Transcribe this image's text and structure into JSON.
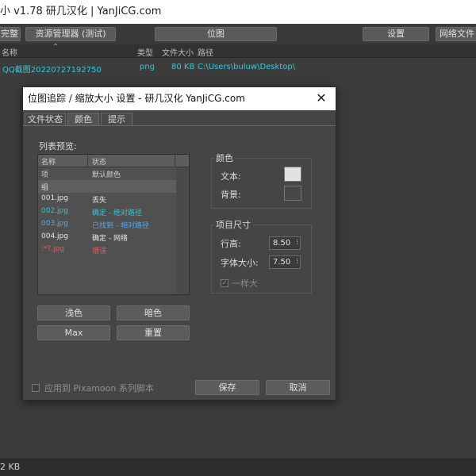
{
  "window": {
    "title": "小  v1.78  研几汉化 | YanJiCG.com"
  },
  "toolbar": {
    "complete_label": "完整",
    "asset_manager_label": "资源管理器 (测试)",
    "bitmap_label": "位图",
    "settings_label": "设置",
    "network_label": "网络文件"
  },
  "file_list": {
    "columns": {
      "name": "名称",
      "type": "类型",
      "size": "文件大小",
      "path": "路径"
    },
    "rows": [
      {
        "name": "QQ截图20220727192750",
        "type": "png",
        "size": "80 KB",
        "path": "C:\\Users\\buluw\\Desktop\\"
      }
    ]
  },
  "status_bar": {
    "text": "2 KB"
  },
  "dialog": {
    "title": "位图追踪 / 缩放大小 设置 - 研几汉化 YanJiCG.com",
    "close_glyph": "✕",
    "tabs": [
      "文件状态",
      "颜色",
      "提示"
    ],
    "active_tab": "颜色",
    "list_preview": {
      "label": "列表预览:",
      "col_name": "名称",
      "col_status": "状态",
      "rows": [
        {
          "name": "项",
          "status": "默认颜色",
          "color": "#cfcfcf"
        },
        {
          "name": "组",
          "status": "",
          "color": "#e0e0e0",
          "group": true
        },
        {
          "name": "001.jpg",
          "status": "丢失",
          "color": "#e6e6e6"
        },
        {
          "name": "002.jpg",
          "status": "确定 - 绝对路径",
          "color": "#33c4d3"
        },
        {
          "name": "003.jpg",
          "status": "已找到 - 相对路径",
          "color": "#5aa8e8"
        },
        {
          "name": "004.jpg",
          "status": "确定 - 网络",
          "color": "#e6e6e6"
        },
        {
          "name": ":*?.jpg",
          "status": "错误",
          "color": "#e85a5a"
        }
      ]
    },
    "buttons": {
      "light": "浅色",
      "dark": "暗色",
      "max": "Max",
      "reset": "重置",
      "save": "保存",
      "cancel": "取消"
    },
    "color_group": {
      "title": "颜色",
      "text_label": "文本:",
      "bg_label": "背景:",
      "text_color": "#e2e2e2",
      "bg_color": "#474747"
    },
    "size_group": {
      "title": "项目尺寸",
      "row_height_label": "行高:",
      "row_height_value": "8.50",
      "font_size_label": "字体大小:",
      "font_size_value": "7.50",
      "same_label": "一样大"
    },
    "apply_label": "应用到 Pixamoon 系列脚本"
  }
}
